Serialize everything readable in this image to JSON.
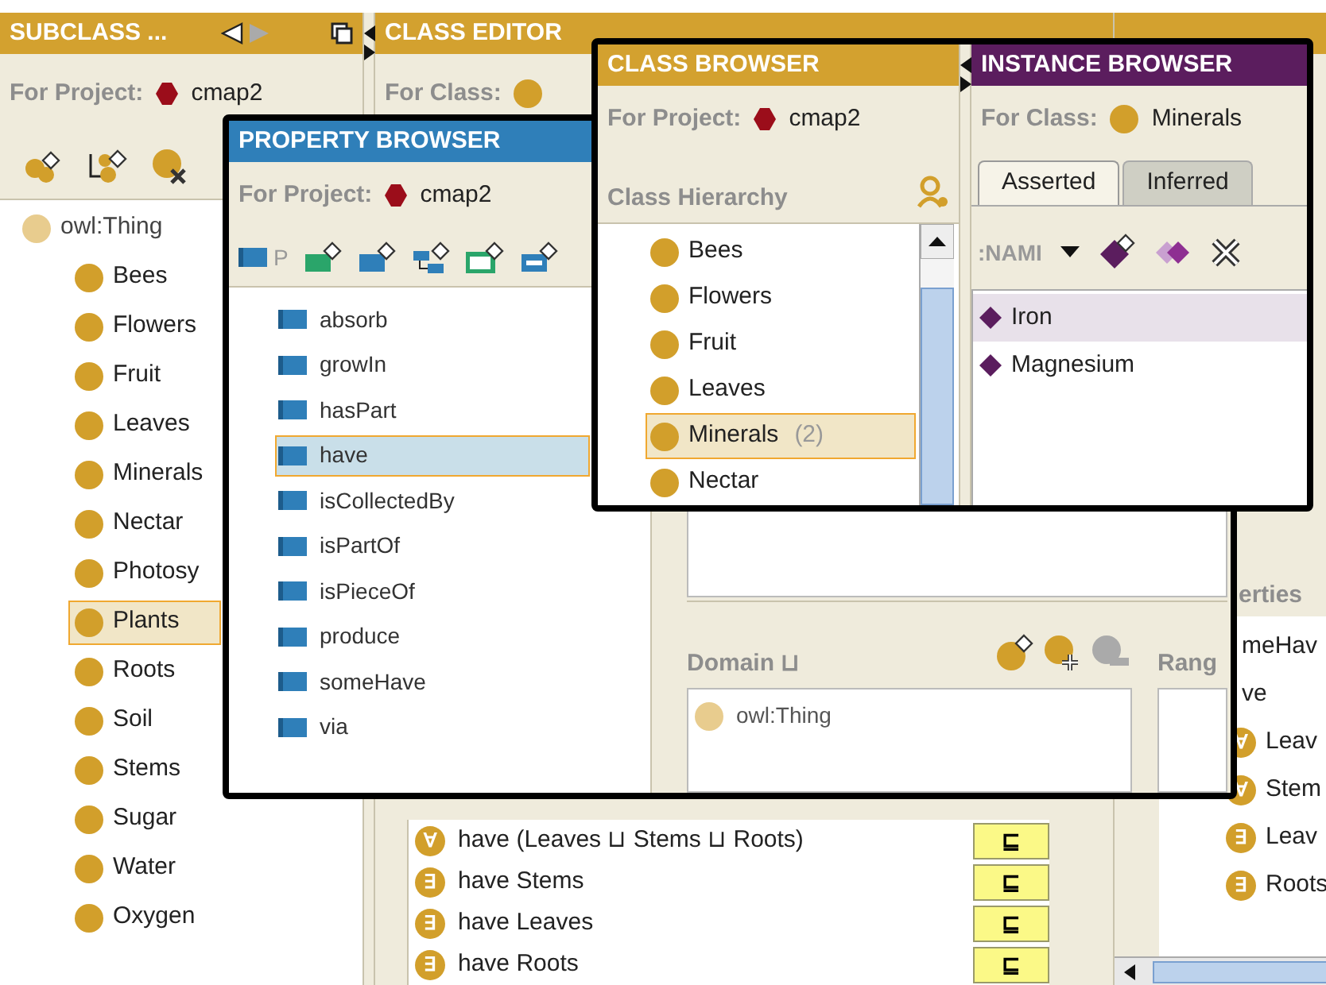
{
  "subclass_panel": {
    "title": "SUBCLASS ...",
    "project_label": "For Project:",
    "project": "cmap2",
    "tree": {
      "label": "owl:Thing",
      "children": [
        {
          "label": "Bees",
          "selected": false
        },
        {
          "label": "Flowers",
          "selected": false
        },
        {
          "label": "Fruit",
          "selected": false
        },
        {
          "label": "Leaves",
          "selected": false
        },
        {
          "label": "Minerals",
          "selected": false
        },
        {
          "label": "Nectar",
          "selected": false
        },
        {
          "label": "Photosy",
          "selected": false
        },
        {
          "label": "Plants",
          "selected": true
        },
        {
          "label": "Roots",
          "selected": false
        },
        {
          "label": "Soil",
          "selected": false
        },
        {
          "label": "Stems",
          "selected": false
        },
        {
          "label": "Sugar",
          "selected": false
        },
        {
          "label": "Water",
          "selected": false
        },
        {
          "label": "Oxygen",
          "selected": false
        }
      ]
    }
  },
  "class_editor": {
    "title": "CLASS EDITOR",
    "class_label": "For Class:",
    "rows": [
      {
        "quantifier": "∀",
        "text": "have (Leaves ⊔ Stems ⊔ Roots)",
        "relation": "⊑"
      },
      {
        "quantifier": "∃",
        "text": "have Stems",
        "relation": "⊑"
      },
      {
        "quantifier": "∃",
        "text": "have Leaves",
        "relation": "⊑"
      },
      {
        "quantifier": "∃",
        "text": "have Roots",
        "relation": "⊑"
      }
    ]
  },
  "right_panel": {
    "section": "erties",
    "rows": [
      {
        "kind": "text",
        "text": "meHav"
      },
      {
        "kind": "text",
        "text": "ve"
      },
      {
        "kind": "restriction",
        "quantifier": "∀",
        "text": "Leav"
      },
      {
        "kind": "restriction",
        "quantifier": "∀",
        "text": "Stem"
      },
      {
        "kind": "restriction",
        "quantifier": "∃",
        "text": "Leav"
      },
      {
        "kind": "restriction",
        "quantifier": "∃",
        "text": "Roots"
      }
    ]
  },
  "property_browser": {
    "title": "PROPERTY BROWSER",
    "project_label": "For Project:",
    "project": "cmap2",
    "toolbar_label": "P",
    "properties": [
      {
        "label": "absorb",
        "selected": false
      },
      {
        "label": "growIn",
        "selected": false
      },
      {
        "label": "hasPart",
        "selected": false
      },
      {
        "label": "have",
        "selected": true
      },
      {
        "label": "isCollectedBy",
        "selected": false
      },
      {
        "label": "isPartOf",
        "selected": false
      },
      {
        "label": "isPieceOf",
        "selected": false
      },
      {
        "label": "produce",
        "selected": false
      },
      {
        "label": "someHave",
        "selected": false
      },
      {
        "label": "via",
        "selected": false
      }
    ]
  },
  "property_editor": {
    "domain_label": "Domain ⊔",
    "domain": [
      "owl:Thing"
    ],
    "range_label": "Rang"
  },
  "class_browser": {
    "title": "CLASS BROWSER",
    "project_label": "For Project:",
    "project": "cmap2",
    "hierarchy_label": "Class Hierarchy",
    "classes": [
      {
        "label": "Bees",
        "selected": false
      },
      {
        "label": "Flowers",
        "selected": false
      },
      {
        "label": "Fruit",
        "selected": false
      },
      {
        "label": "Leaves",
        "selected": false
      },
      {
        "label": "Minerals",
        "count": "(2)",
        "selected": true
      },
      {
        "label": "Nectar",
        "selected": false
      }
    ]
  },
  "instance_browser": {
    "title": "INSTANCE BROWSER",
    "class_label": "For Class:",
    "class": "Minerals",
    "tabs": [
      {
        "label": "Asserted",
        "selected": true
      },
      {
        "label": "Inferred",
        "selected": false
      }
    ],
    "column": ":NAMI",
    "instances": [
      {
        "label": "Iron",
        "selected": true
      },
      {
        "label": "Magnesium",
        "selected": false
      }
    ]
  }
}
